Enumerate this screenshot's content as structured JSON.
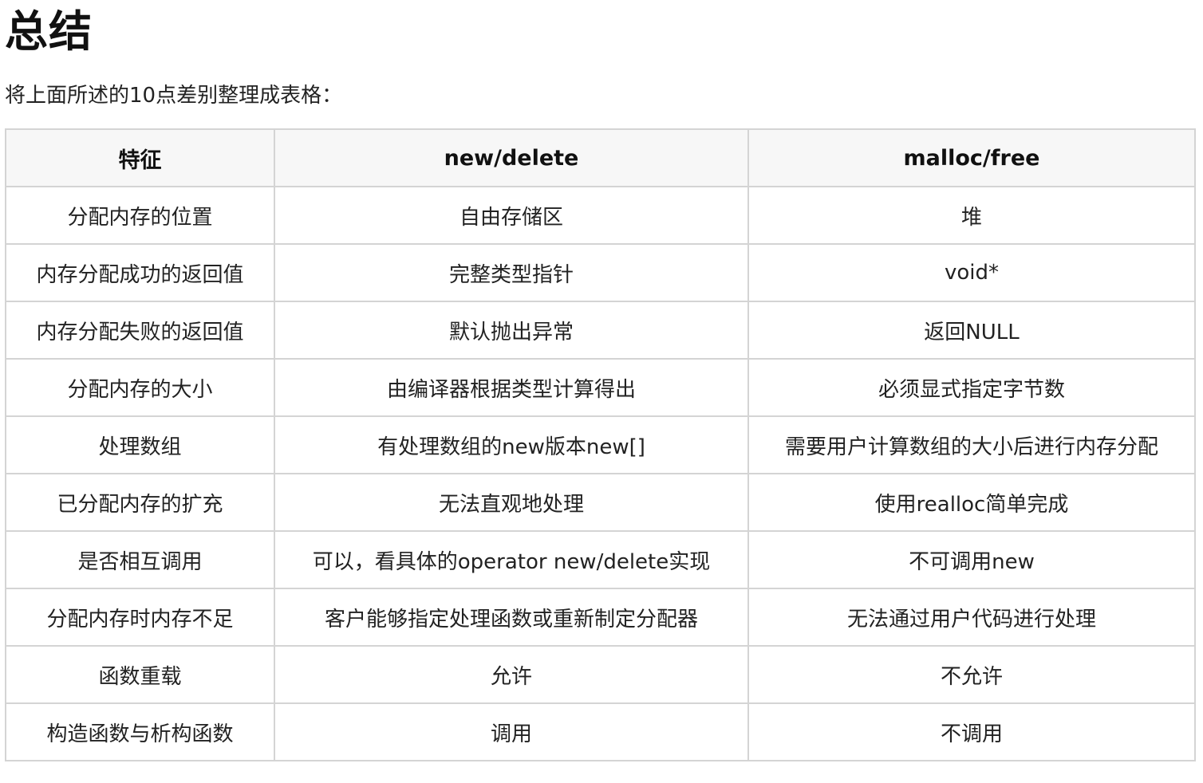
{
  "title": "总结",
  "intro": "将上面所述的10点差别整理成表格：",
  "table": {
    "headers": [
      "特征",
      "new/delete",
      "malloc/free"
    ],
    "rows": [
      [
        "分配内存的位置",
        "自由存储区",
        "堆"
      ],
      [
        "内存分配成功的返回值",
        "完整类型指针",
        "void*"
      ],
      [
        "内存分配失败的返回值",
        "默认抛出异常",
        "返回NULL"
      ],
      [
        "分配内存的大小",
        "由编译器根据类型计算得出",
        "必须显式指定字节数"
      ],
      [
        "处理数组",
        "有处理数组的new版本new[]",
        "需要用户计算数组的大小后进行内存分配"
      ],
      [
        "已分配内存的扩充",
        "无法直观地处理",
        "使用realloc简单完成"
      ],
      [
        "是否相互调用",
        "可以，看具体的operator new/delete实现",
        "不可调用new"
      ],
      [
        "分配内存时内存不足",
        "客户能够指定处理函数或重新制定分配器",
        "无法通过用户代码进行处理"
      ],
      [
        "函数重载",
        "允许",
        "不允许"
      ],
      [
        "构造函数与析构函数",
        "调用",
        "不调用"
      ]
    ]
  }
}
